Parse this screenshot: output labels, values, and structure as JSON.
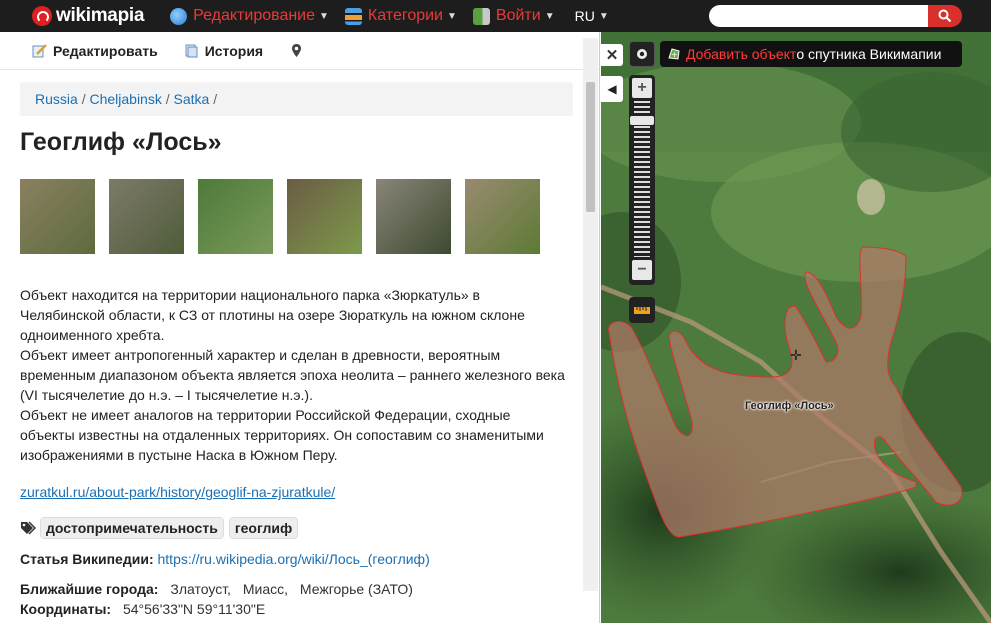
{
  "topbar": {
    "logo_text": "wikimapia",
    "menu": [
      {
        "label": "Редактирование",
        "icon": "globe-icon"
      },
      {
        "label": "Категории",
        "icon": "categories-icon"
      },
      {
        "label": "Войти",
        "icon": "login-icon"
      }
    ],
    "language": "RU",
    "search_placeholder": ""
  },
  "panel": {
    "toolbar": {
      "edit_label": "Редактировать",
      "history_label": "История"
    },
    "breadcrumb": [
      "Russia",
      "Cheljabinsk",
      "Satka"
    ],
    "breadcrumb_sep": "/",
    "title": "Геоглиф «Лось»",
    "thumbnails": [
      {
        "colors": [
          "#8a8060",
          "#5d6b3e"
        ]
      },
      {
        "colors": [
          "#7d7a68",
          "#4f5c3a"
        ]
      },
      {
        "colors": [
          "#4e7a3a",
          "#7a9a5a"
        ]
      },
      {
        "colors": [
          "#6b5c45",
          "#7d9a4a"
        ]
      },
      {
        "colors": [
          "#8a8578",
          "#3c4a30"
        ]
      },
      {
        "colors": [
          "#9a8a70",
          "#5c7a35"
        ]
      }
    ],
    "description": [
      "Объект находится на территории национального парка «Зюркатуль» в Челябинской области, к СЗ от плотины на озере Зюраткуль на южном склоне одноименного хребта.",
      "Объект имеет антропогенный характер и сделан в древности, вероятным временным диапазоном объекта является эпоха неолита – раннего железного века (VI тысячелетие до н.э. – I тысячелетие н.э.).",
      "Объект не имеет аналогов на территории Российской Федерации, сходные объекты известны на отдаленных территориях. Он сопоставим со знаменитыми изображениями в пустыне Наска в Южном Перу."
    ],
    "external_link": "zuratkul.ru/about-park/history/geoglif-na-zjuratkule/",
    "tags": [
      "достопримечательность",
      "геоглиф"
    ],
    "wiki": {
      "label": "Статья Википедии:",
      "url": "https://ru.wikipedia.org/wiki/Лось_(геоглиф)"
    },
    "nearest_cities": {
      "label": "Ближайшие города:",
      "cities": [
        "Златоуст,",
        "Миасс,",
        "Межгорье (ЗАТО)"
      ]
    },
    "coordinates": {
      "label": "Координаты:",
      "value": "54°56'33\"N 59°11'30\"E"
    }
  },
  "map": {
    "add_object_label": "Добавить объект",
    "satellite_label": "о спутника Викимапии",
    "object_label": "Геоглиф «Лось»",
    "zoom_in": "+",
    "zoom_out": "−",
    "zoom_level_fraction": 0.88,
    "colors": {
      "polygon_fill": "#b07a6a",
      "polygon_stroke": "#e23030",
      "forest": "#3f6a35",
      "meadow": "#6f9b55"
    }
  }
}
